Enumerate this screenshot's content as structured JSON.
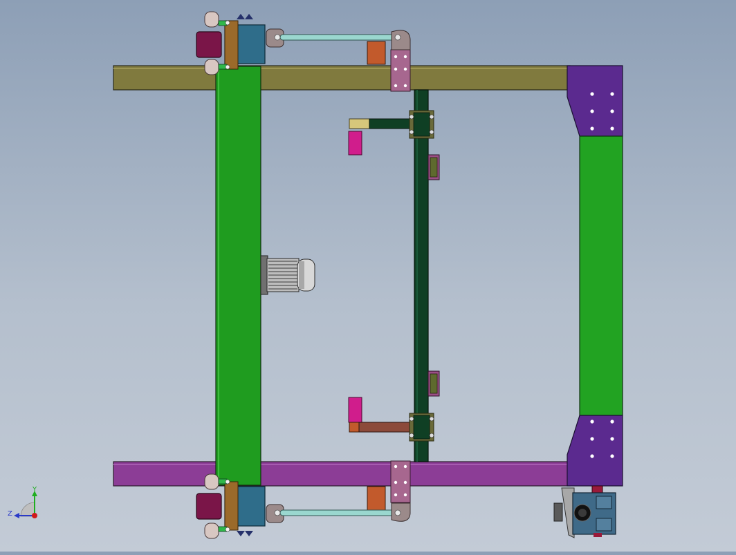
{
  "view": {
    "title": "",
    "triad": {
      "x_label": "",
      "y_label": "Y",
      "z_label": "Z"
    }
  },
  "colors": {
    "background_top": "#8d9fb6",
    "background_bottom": "#c3cbd6",
    "upper_rail": "#807a3e",
    "lower_rail": "#8c3d96",
    "main_beam": "#1f9c1f",
    "end_beam": "#22a322",
    "end_plate": "#5b2a8f",
    "trolley_rail": "#0f3f24",
    "bearing_housing": "#2f6d8a",
    "shaft": "#9ad7cf",
    "clamp": "#a7678f",
    "wheel_block": "#7a1548",
    "bracket_orange": "#c25a2c",
    "bracket_pink": "#d01d8c",
    "motor": "#9a9a9a",
    "gearbox": "#3f6a88"
  },
  "components": [
    {
      "id": "upper-rail",
      "name": "upper-rail-beam"
    },
    {
      "id": "lower-rail",
      "name": "lower-rail-beam"
    },
    {
      "id": "main-beam",
      "name": "main-girder"
    },
    {
      "id": "end-beam",
      "name": "end-girder"
    },
    {
      "id": "trolley-rail",
      "name": "trolley-guide-rail"
    },
    {
      "id": "drive-motor",
      "name": "drive-motor"
    },
    {
      "id": "gear-motor",
      "name": "gear-motor-unit"
    }
  ]
}
